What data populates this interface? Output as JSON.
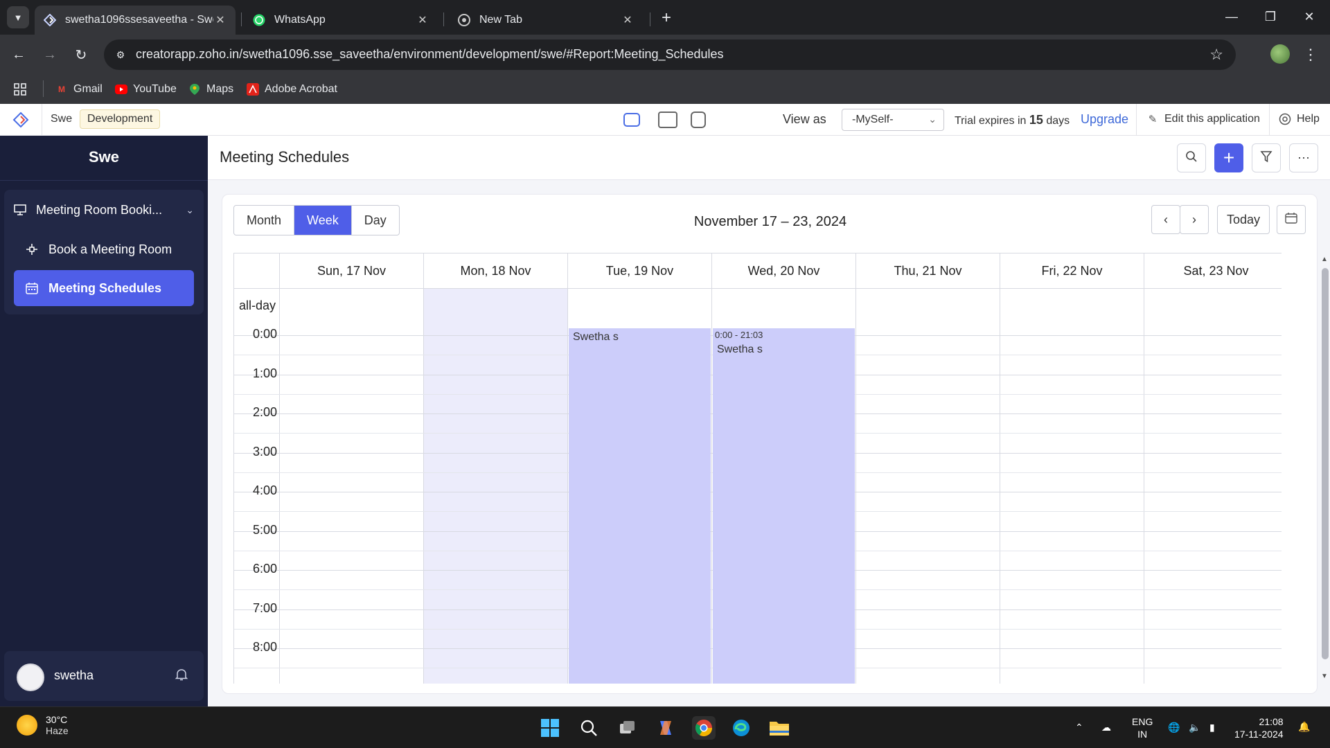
{
  "browser": {
    "tabs": [
      {
        "title": "swetha1096ssesaveetha - Swe",
        "active": true,
        "icon": "zoho-creator-icon"
      },
      {
        "title": "WhatsApp",
        "active": false,
        "icon": "whatsapp-icon"
      },
      {
        "title": "New Tab",
        "active": false,
        "icon": "chrome-icon"
      }
    ],
    "url": "creatorapp.zoho.in/swetha1096.sse_saveetha/environment/development/swe/#Report:Meeting_Schedules",
    "bookmarks": [
      {
        "label": "Gmail",
        "icon": "gmail-icon",
        "color": "#ea4335"
      },
      {
        "label": "YouTube",
        "icon": "youtube-icon",
        "color": "#ff0000"
      },
      {
        "label": "Maps",
        "icon": "maps-icon",
        "color": "#34a853"
      },
      {
        "label": "Adobe Acrobat",
        "icon": "acrobat-icon",
        "color": "#e2231a"
      }
    ]
  },
  "appbar": {
    "app_name": "Swe",
    "environment": "Development",
    "view_as_label": "View as",
    "view_as_value": "-MySelf-",
    "trial_prefix": "Trial expires in",
    "trial_days": "15",
    "trial_suffix": "days",
    "upgrade": "Upgrade",
    "edit_app": "Edit this application",
    "help": "Help",
    "accent": "#4f5ee8"
  },
  "sidebar": {
    "title": "Swe",
    "group_label": "Meeting Room Booki...",
    "items": [
      {
        "label": "Book a Meeting Room",
        "icon": "plus-move-icon",
        "active": false
      },
      {
        "label": "Meeting Schedules",
        "icon": "calendar-icon",
        "active": true
      }
    ],
    "user": "swetha"
  },
  "main": {
    "title": "Meeting Schedules",
    "view_tabs": [
      "Month",
      "Week",
      "Day"
    ],
    "active_view": "Week",
    "date_range": "November 17 – 23, 2024",
    "today_label": "Today",
    "all_day_label": "all-day",
    "days": [
      "Sun, 17 Nov",
      "Mon, 18 Nov",
      "Tue, 19 Nov",
      "Wed, 20 Nov",
      "Thu, 21 Nov",
      "Fri, 22 Nov",
      "Sat, 23 Nov"
    ],
    "today_index": 1,
    "hours": [
      "0:00",
      "1:00",
      "2:00",
      "3:00",
      "4:00",
      "5:00",
      "6:00",
      "7:00",
      "8:00"
    ],
    "events": [
      {
        "day_index": 2,
        "name": "Swetha s",
        "time": ""
      },
      {
        "day_index": 3,
        "name": "Swetha s",
        "time": "0:00 - 21:03"
      }
    ]
  },
  "taskbar": {
    "temperature": "30°C",
    "weather": "Haze",
    "lang_top": "ENG",
    "lang_bottom": "IN",
    "time": "21:08",
    "date": "17-11-2024"
  }
}
